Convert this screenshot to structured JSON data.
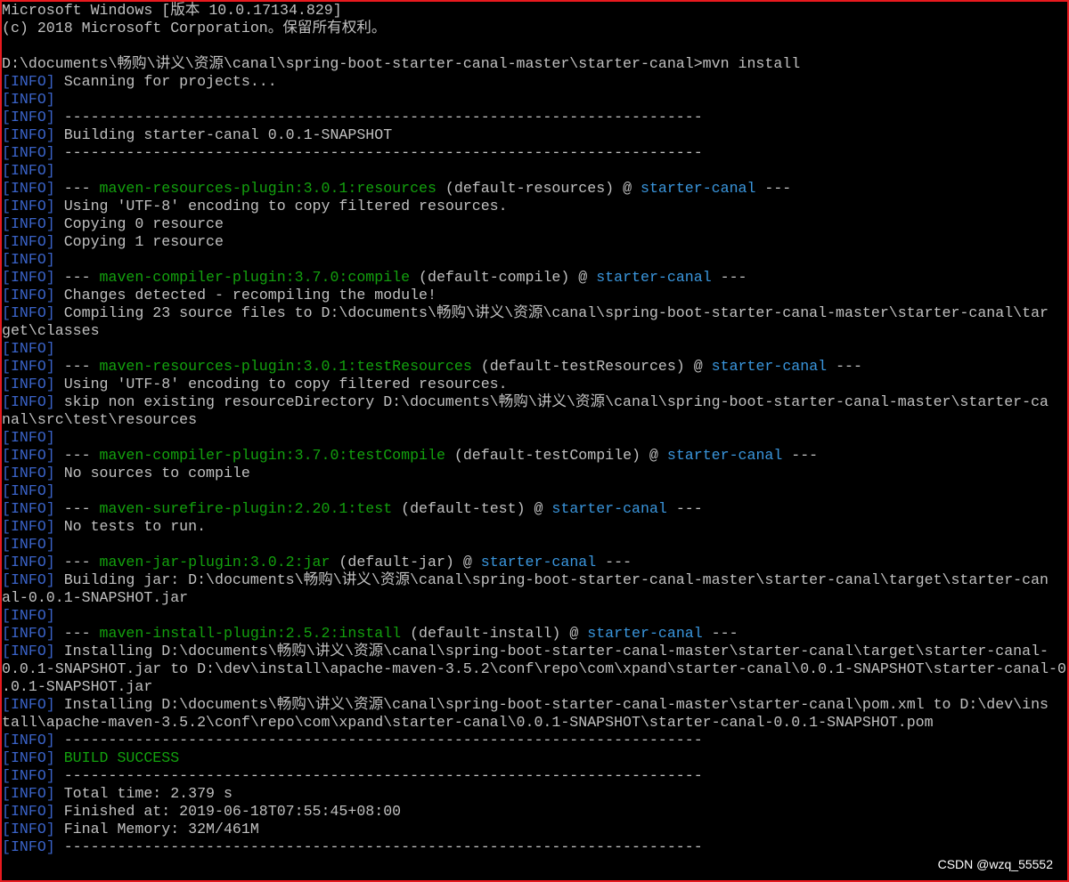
{
  "colors": {
    "background": "#000000",
    "text": "#c0c0c0",
    "info": "#3a63c8",
    "plugin": "#13a10e",
    "project": "#3a96dd",
    "success": "#13a10e",
    "border": "#e8191e"
  },
  "watermark": "CSDN @wzq_55552",
  "lines": [
    {
      "segments": [
        {
          "t": "Microsoft Windows [版本 10.0.17134.829]"
        }
      ]
    },
    {
      "segments": [
        {
          "t": "(c) 2018 Microsoft Corporation。保留所有权利。"
        }
      ]
    },
    {
      "segments": [
        {
          "t": ""
        }
      ]
    },
    {
      "segments": [
        {
          "t": "D:\\documents\\畅购\\讲义\\资源\\canal\\spring-boot-starter-canal-master\\starter-canal>mvn install"
        }
      ]
    },
    {
      "segments": [
        {
          "t": "[INFO]",
          "s": "info"
        },
        {
          "t": " Scanning for projects..."
        }
      ]
    },
    {
      "segments": [
        {
          "t": "[INFO]",
          "s": "info"
        }
      ]
    },
    {
      "segments": [
        {
          "t": "[INFO]",
          "s": "info"
        },
        {
          "t": " ------------------------------------------------------------------------"
        }
      ]
    },
    {
      "segments": [
        {
          "t": "[INFO]",
          "s": "info"
        },
        {
          "t": " Building starter-canal 0.0.1-SNAPSHOT"
        }
      ]
    },
    {
      "segments": [
        {
          "t": "[INFO]",
          "s": "info"
        },
        {
          "t": " ------------------------------------------------------------------------"
        }
      ]
    },
    {
      "segments": [
        {
          "t": "[INFO]",
          "s": "info"
        }
      ]
    },
    {
      "segments": [
        {
          "t": "[INFO]",
          "s": "info"
        },
        {
          "t": " --- "
        },
        {
          "t": "maven-resources-plugin:3.0.1:resources",
          "s": "plugin"
        },
        {
          "t": " (default-resources) @ "
        },
        {
          "t": "starter-canal",
          "s": "project"
        },
        {
          "t": " ---"
        }
      ]
    },
    {
      "segments": [
        {
          "t": "[INFO]",
          "s": "info"
        },
        {
          "t": " Using 'UTF-8' encoding to copy filtered resources."
        }
      ]
    },
    {
      "segments": [
        {
          "t": "[INFO]",
          "s": "info"
        },
        {
          "t": " Copying 0 resource"
        }
      ]
    },
    {
      "segments": [
        {
          "t": "[INFO]",
          "s": "info"
        },
        {
          "t": " Copying 1 resource"
        }
      ]
    },
    {
      "segments": [
        {
          "t": "[INFO]",
          "s": "info"
        }
      ]
    },
    {
      "segments": [
        {
          "t": "[INFO]",
          "s": "info"
        },
        {
          "t": " --- "
        },
        {
          "t": "maven-compiler-plugin:3.7.0:compile",
          "s": "plugin"
        },
        {
          "t": " (default-compile) @ "
        },
        {
          "t": "starter-canal",
          "s": "project"
        },
        {
          "t": " ---"
        }
      ]
    },
    {
      "segments": [
        {
          "t": "[INFO]",
          "s": "info"
        },
        {
          "t": " Changes detected - recompiling the module!"
        }
      ]
    },
    {
      "segments": [
        {
          "t": "[INFO]",
          "s": "info"
        },
        {
          "t": " Compiling 23 source files to D:\\documents\\畅购\\讲义\\资源\\canal\\spring-boot-starter-canal-master\\starter-canal\\tar"
        }
      ]
    },
    {
      "segments": [
        {
          "t": "get\\classes"
        }
      ]
    },
    {
      "segments": [
        {
          "t": "[INFO]",
          "s": "info"
        }
      ]
    },
    {
      "segments": [
        {
          "t": "[INFO]",
          "s": "info"
        },
        {
          "t": " --- "
        },
        {
          "t": "maven-resources-plugin:3.0.1:testResources",
          "s": "plugin"
        },
        {
          "t": " (default-testResources) @ "
        },
        {
          "t": "starter-canal",
          "s": "project"
        },
        {
          "t": " ---"
        }
      ]
    },
    {
      "segments": [
        {
          "t": "[INFO]",
          "s": "info"
        },
        {
          "t": " Using 'UTF-8' encoding to copy filtered resources."
        }
      ]
    },
    {
      "segments": [
        {
          "t": "[INFO]",
          "s": "info"
        },
        {
          "t": " skip non existing resourceDirectory D:\\documents\\畅购\\讲义\\资源\\canal\\spring-boot-starter-canal-master\\starter-ca"
        }
      ]
    },
    {
      "segments": [
        {
          "t": "nal\\src\\test\\resources"
        }
      ]
    },
    {
      "segments": [
        {
          "t": "[INFO]",
          "s": "info"
        }
      ]
    },
    {
      "segments": [
        {
          "t": "[INFO]",
          "s": "info"
        },
        {
          "t": " --- "
        },
        {
          "t": "maven-compiler-plugin:3.7.0:testCompile",
          "s": "plugin"
        },
        {
          "t": " (default-testCompile) @ "
        },
        {
          "t": "starter-canal",
          "s": "project"
        },
        {
          "t": " ---"
        }
      ]
    },
    {
      "segments": [
        {
          "t": "[INFO]",
          "s": "info"
        },
        {
          "t": " No sources to compile"
        }
      ]
    },
    {
      "segments": [
        {
          "t": "[INFO]",
          "s": "info"
        }
      ]
    },
    {
      "segments": [
        {
          "t": "[INFO]",
          "s": "info"
        },
        {
          "t": " --- "
        },
        {
          "t": "maven-surefire-plugin:2.20.1:test",
          "s": "plugin"
        },
        {
          "t": " (default-test) @ "
        },
        {
          "t": "starter-canal",
          "s": "project"
        },
        {
          "t": " ---"
        }
      ]
    },
    {
      "segments": [
        {
          "t": "[INFO]",
          "s": "info"
        },
        {
          "t": " No tests to run."
        }
      ]
    },
    {
      "segments": [
        {
          "t": "[INFO]",
          "s": "info"
        }
      ]
    },
    {
      "segments": [
        {
          "t": "[INFO]",
          "s": "info"
        },
        {
          "t": " --- "
        },
        {
          "t": "maven-jar-plugin:3.0.2:jar",
          "s": "plugin"
        },
        {
          "t": " (default-jar) @ "
        },
        {
          "t": "starter-canal",
          "s": "project"
        },
        {
          "t": " ---"
        }
      ]
    },
    {
      "segments": [
        {
          "t": "[INFO]",
          "s": "info"
        },
        {
          "t": " Building jar: D:\\documents\\畅购\\讲义\\资源\\canal\\spring-boot-starter-canal-master\\starter-canal\\target\\starter-can"
        }
      ]
    },
    {
      "segments": [
        {
          "t": "al-0.0.1-SNAPSHOT.jar"
        }
      ]
    },
    {
      "segments": [
        {
          "t": "[INFO]",
          "s": "info"
        }
      ]
    },
    {
      "segments": [
        {
          "t": "[INFO]",
          "s": "info"
        },
        {
          "t": " --- "
        },
        {
          "t": "maven-install-plugin:2.5.2:install",
          "s": "plugin"
        },
        {
          "t": " (default-install) @ "
        },
        {
          "t": "starter-canal",
          "s": "project"
        },
        {
          "t": " ---"
        }
      ]
    },
    {
      "segments": [
        {
          "t": "[INFO]",
          "s": "info"
        },
        {
          "t": " Installing D:\\documents\\畅购\\讲义\\资源\\canal\\spring-boot-starter-canal-master\\starter-canal\\target\\starter-canal-"
        }
      ]
    },
    {
      "segments": [
        {
          "t": "0.0.1-SNAPSHOT.jar to D:\\dev\\install\\apache-maven-3.5.2\\conf\\repo\\com\\xpand\\starter-canal\\0.0.1-SNAPSHOT\\starter-canal-0"
        }
      ]
    },
    {
      "segments": [
        {
          "t": ".0.1-SNAPSHOT.jar"
        }
      ]
    },
    {
      "segments": [
        {
          "t": "[INFO]",
          "s": "info"
        },
        {
          "t": " Installing D:\\documents\\畅购\\讲义\\资源\\canal\\spring-boot-starter-canal-master\\starter-canal\\pom.xml to D:\\dev\\ins"
        }
      ]
    },
    {
      "segments": [
        {
          "t": "tall\\apache-maven-3.5.2\\conf\\repo\\com\\xpand\\starter-canal\\0.0.1-SNAPSHOT\\starter-canal-0.0.1-SNAPSHOT.pom"
        }
      ]
    },
    {
      "segments": [
        {
          "t": "[INFO]",
          "s": "info"
        },
        {
          "t": " ------------------------------------------------------------------------"
        }
      ]
    },
    {
      "segments": [
        {
          "t": "[INFO]",
          "s": "info"
        },
        {
          "t": " "
        },
        {
          "t": "BUILD SUCCESS",
          "s": "success"
        }
      ]
    },
    {
      "segments": [
        {
          "t": "[INFO]",
          "s": "info"
        },
        {
          "t": " ------------------------------------------------------------------------"
        }
      ]
    },
    {
      "segments": [
        {
          "t": "[INFO]",
          "s": "info"
        },
        {
          "t": " Total time: 2.379 s"
        }
      ]
    },
    {
      "segments": [
        {
          "t": "[INFO]",
          "s": "info"
        },
        {
          "t": " Finished at: 2019-06-18T07:55:45+08:00"
        }
      ]
    },
    {
      "segments": [
        {
          "t": "[INFO]",
          "s": "info"
        },
        {
          "t": " Final Memory: 32M/461M"
        }
      ]
    },
    {
      "segments": [
        {
          "t": "[INFO]",
          "s": "info"
        },
        {
          "t": " ------------------------------------------------------------------------"
        }
      ]
    }
  ]
}
